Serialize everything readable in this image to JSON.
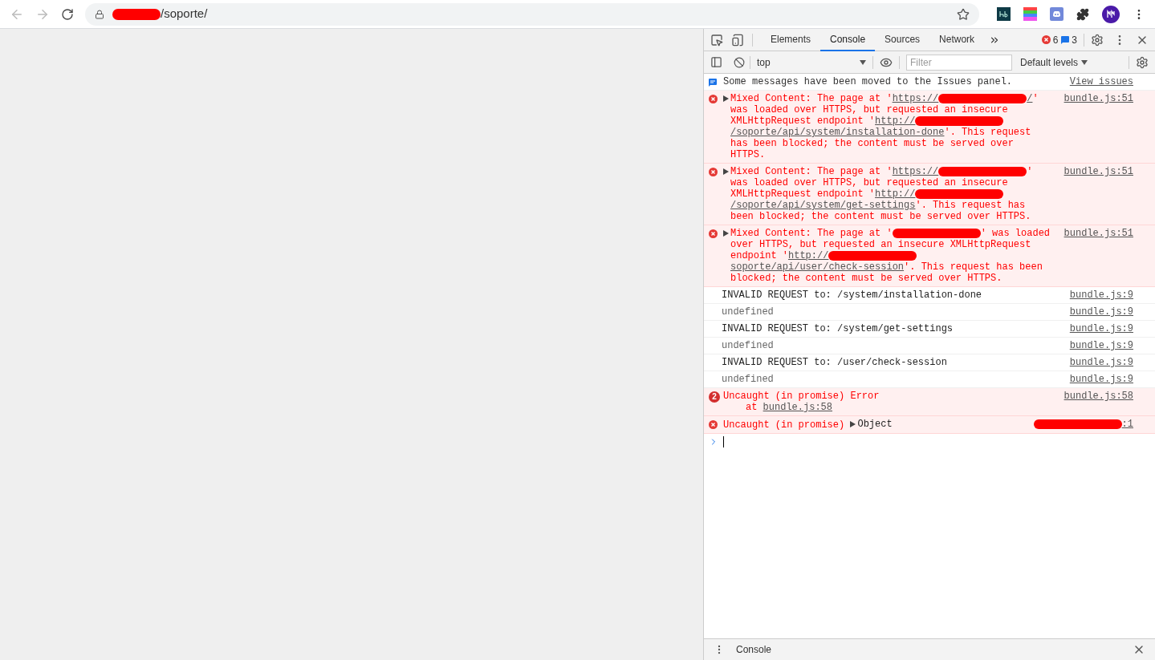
{
  "browser": {
    "address": {
      "path": "/soporte/"
    }
  },
  "devtools": {
    "tabs": [
      {
        "label": "Elements",
        "selected": false
      },
      {
        "label": "Console",
        "selected": true
      },
      {
        "label": "Sources",
        "selected": false
      },
      {
        "label": "Network",
        "selected": false
      }
    ],
    "error_count": "6",
    "message_count": "3",
    "context": "top",
    "filter": {
      "placeholder": "Filter"
    },
    "levels": "Default levels",
    "messages": [
      {
        "kind": "info",
        "parts": [
          {
            "kind": "text",
            "text": "Some messages have been moved to the Issues panel."
          }
        ],
        "source": [
          {
            "kind": "link",
            "text": "View issues"
          }
        ]
      },
      {
        "kind": "error",
        "expandable": true,
        "parts": [
          {
            "kind": "text",
            "text": "Mixed Content: The page at '"
          },
          {
            "kind": "link",
            "text": "https://"
          },
          {
            "kind": "redacted"
          },
          {
            "kind": "link",
            "text": "/"
          },
          {
            "kind": "text",
            "text": "' was loaded over HTTPS, but requested an insecure XMLHttpRequest endpoint '"
          },
          {
            "kind": "link",
            "text": "http://"
          },
          {
            "kind": "redacted"
          },
          {
            "kind": "link",
            "text": "/soporte/api/system/installation-done"
          },
          {
            "kind": "text",
            "text": "'. This request has been blocked; the content must be served over HTTPS."
          }
        ],
        "source": [
          {
            "kind": "link",
            "text": "bundle.js:51"
          }
        ]
      },
      {
        "kind": "error",
        "expandable": true,
        "parts": [
          {
            "kind": "text",
            "text": "Mixed Content: The page at '"
          },
          {
            "kind": "link",
            "text": "https://"
          },
          {
            "kind": "redacted"
          },
          {
            "kind": "text",
            "text": "' was loaded over HTTPS, but requested an insecure XMLHttpRequest endpoint '"
          },
          {
            "kind": "link",
            "text": "http://"
          },
          {
            "kind": "redacted"
          },
          {
            "kind": "link",
            "text": "/soporte/api/system/get-settings"
          },
          {
            "kind": "text",
            "text": "'. This request has been blocked; the content must be served over HTTPS."
          }
        ],
        "source": [
          {
            "kind": "link",
            "text": "bundle.js:51"
          }
        ]
      },
      {
        "kind": "error",
        "expandable": true,
        "parts": [
          {
            "kind": "text",
            "text": "Mixed Content: The page at '"
          },
          {
            "kind": "redacted"
          },
          {
            "kind": "text",
            "text": "' was loaded over HTTPS, but requested an insecure XMLHttpRequest endpoint '"
          },
          {
            "kind": "link",
            "text": "http://"
          },
          {
            "kind": "redacted"
          },
          {
            "kind": "link",
            "text": "soporte/api/user/check-session"
          },
          {
            "kind": "text",
            "text": "'. This request has been blocked; the content must be served over HTTPS."
          }
        ],
        "source": [
          {
            "kind": "link",
            "text": "bundle.js:51"
          }
        ]
      },
      {
        "kind": "log",
        "parts": [
          {
            "kind": "text",
            "text": "INVALID REQUEST to: /system/installation-done"
          }
        ],
        "source": [
          {
            "kind": "link",
            "text": "bundle.js:9"
          }
        ]
      },
      {
        "kind": "undefined",
        "parts": [
          {
            "kind": "text",
            "text": "undefined"
          }
        ],
        "source": [
          {
            "kind": "link",
            "text": "bundle.js:9"
          }
        ]
      },
      {
        "kind": "log",
        "parts": [
          {
            "kind": "text",
            "text": "INVALID REQUEST to: /system/get-settings"
          }
        ],
        "source": [
          {
            "kind": "link",
            "text": "bundle.js:9"
          }
        ]
      },
      {
        "kind": "undefined",
        "parts": [
          {
            "kind": "text",
            "text": "undefined"
          }
        ],
        "source": [
          {
            "kind": "link",
            "text": "bundle.js:9"
          }
        ]
      },
      {
        "kind": "log",
        "parts": [
          {
            "kind": "text",
            "text": "INVALID REQUEST to: /user/check-session"
          }
        ],
        "source": [
          {
            "kind": "link",
            "text": "bundle.js:9"
          }
        ]
      },
      {
        "kind": "undefined",
        "parts": [
          {
            "kind": "text",
            "text": "undefined"
          }
        ],
        "source": [
          {
            "kind": "link",
            "text": "bundle.js:9"
          }
        ]
      },
      {
        "kind": "error",
        "count": "2",
        "parts": [
          {
            "kind": "text",
            "text": "Uncaught (in promise) Error"
          }
        ],
        "stack": [
          {
            "kind": "text",
            "text": "at "
          },
          {
            "kind": "link",
            "text": "bundle.js:58"
          }
        ],
        "source": [
          {
            "kind": "link",
            "text": "bundle.js:58"
          }
        ]
      },
      {
        "kind": "error",
        "parts": [
          {
            "kind": "text",
            "text": "Uncaught (in promise) "
          },
          {
            "kind": "object",
            "text": "Object"
          }
        ],
        "source": [
          {
            "kind": "redacted"
          },
          {
            "kind": "link",
            "text": ":1"
          }
        ]
      }
    ],
    "drawer": {
      "tab": "Console"
    }
  }
}
